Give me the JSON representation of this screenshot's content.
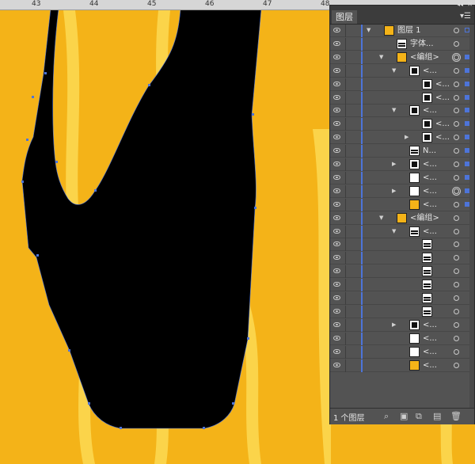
{
  "ruler": {
    "ticks": [
      "43",
      "44",
      "45",
      "46",
      "47",
      "48"
    ]
  },
  "panel": {
    "tab_title": "图层",
    "collapse_icon": "double-chevron-icon",
    "menu_icon": "panel-menu-icon",
    "footer_label": "1 个图层",
    "footer_icons": [
      "search-icon",
      "make-clip-icon",
      "sublayer-icon",
      "new-layer-icon",
      "delete-icon"
    ]
  },
  "layers": [
    {
      "label": "图层 1",
      "indent": 0,
      "tri": "down",
      "thumb": "orange",
      "circ": "single",
      "sq": "small"
    },
    {
      "label": "字体...",
      "indent": 1,
      "tri": "",
      "thumb": "lines",
      "circ": "single",
      "sq": ""
    },
    {
      "label": "<编组>",
      "indent": 1,
      "tri": "down",
      "thumb": "orange",
      "circ": "double",
      "sq": "fill"
    },
    {
      "label": "<...",
      "indent": 2,
      "tri": "down",
      "thumb": "dark",
      "circ": "single",
      "sq": "fill"
    },
    {
      "label": "<...",
      "indent": 3,
      "tri": "",
      "thumb": "dark",
      "circ": "single",
      "sq": "fill"
    },
    {
      "label": "<...",
      "indent": 3,
      "tri": "",
      "thumb": "dark",
      "circ": "single",
      "sq": "fill"
    },
    {
      "label": "<...",
      "indent": 2,
      "tri": "down",
      "thumb": "dark",
      "circ": "single",
      "sq": "fill"
    },
    {
      "label": "<...",
      "indent": 3,
      "tri": "",
      "thumb": "dark",
      "circ": "single",
      "sq": "fill"
    },
    {
      "label": "<...",
      "indent": 3,
      "tri": "right",
      "thumb": "dark",
      "circ": "single",
      "sq": "fill"
    },
    {
      "label": "N...",
      "indent": 2,
      "tri": "",
      "thumb": "lines",
      "circ": "single",
      "sq": "fill"
    },
    {
      "label": "<...",
      "indent": 2,
      "tri": "right",
      "thumb": "dark",
      "circ": "single",
      "sq": "fill"
    },
    {
      "label": "<...",
      "indent": 2,
      "tri": "",
      "thumb": "white",
      "circ": "single",
      "sq": "fill"
    },
    {
      "label": "<...",
      "indent": 2,
      "tri": "right",
      "thumb": "white",
      "circ": "double",
      "sq": "fill"
    },
    {
      "label": "<...",
      "indent": 2,
      "tri": "",
      "thumb": "orange",
      "circ": "single",
      "sq": "fill"
    },
    {
      "label": "<编组>",
      "indent": 1,
      "tri": "down",
      "thumb": "orange",
      "circ": "single",
      "sq": ""
    },
    {
      "label": "<...",
      "indent": 2,
      "tri": "down",
      "thumb": "lines",
      "circ": "single",
      "sq": ""
    },
    {
      "label": "",
      "indent": 3,
      "tri": "",
      "thumb": "lines",
      "circ": "single",
      "sq": ""
    },
    {
      "label": "",
      "indent": 3,
      "tri": "",
      "thumb": "lines",
      "circ": "single",
      "sq": ""
    },
    {
      "label": "",
      "indent": 3,
      "tri": "",
      "thumb": "lines",
      "circ": "single",
      "sq": ""
    },
    {
      "label": "",
      "indent": 3,
      "tri": "",
      "thumb": "lines",
      "circ": "single",
      "sq": ""
    },
    {
      "label": "",
      "indent": 3,
      "tri": "",
      "thumb": "lines",
      "circ": "single",
      "sq": ""
    },
    {
      "label": "",
      "indent": 3,
      "tri": "",
      "thumb": "lines",
      "circ": "single",
      "sq": ""
    },
    {
      "label": "<...",
      "indent": 2,
      "tri": "right",
      "thumb": "dark",
      "circ": "single",
      "sq": ""
    },
    {
      "label": "<...",
      "indent": 2,
      "tri": "",
      "thumb": "white",
      "circ": "single",
      "sq": ""
    },
    {
      "label": "<...",
      "indent": 2,
      "tri": "",
      "thumb": "white",
      "circ": "single",
      "sq": ""
    },
    {
      "label": "<...",
      "indent": 2,
      "tri": "",
      "thumb": "orange",
      "circ": "single",
      "sq": ""
    }
  ],
  "colors": {
    "canvas": "#f4b318",
    "shape": "#000000",
    "stripe": "#fbd44a",
    "selection": "#4d74d9",
    "panel": "#535353"
  }
}
